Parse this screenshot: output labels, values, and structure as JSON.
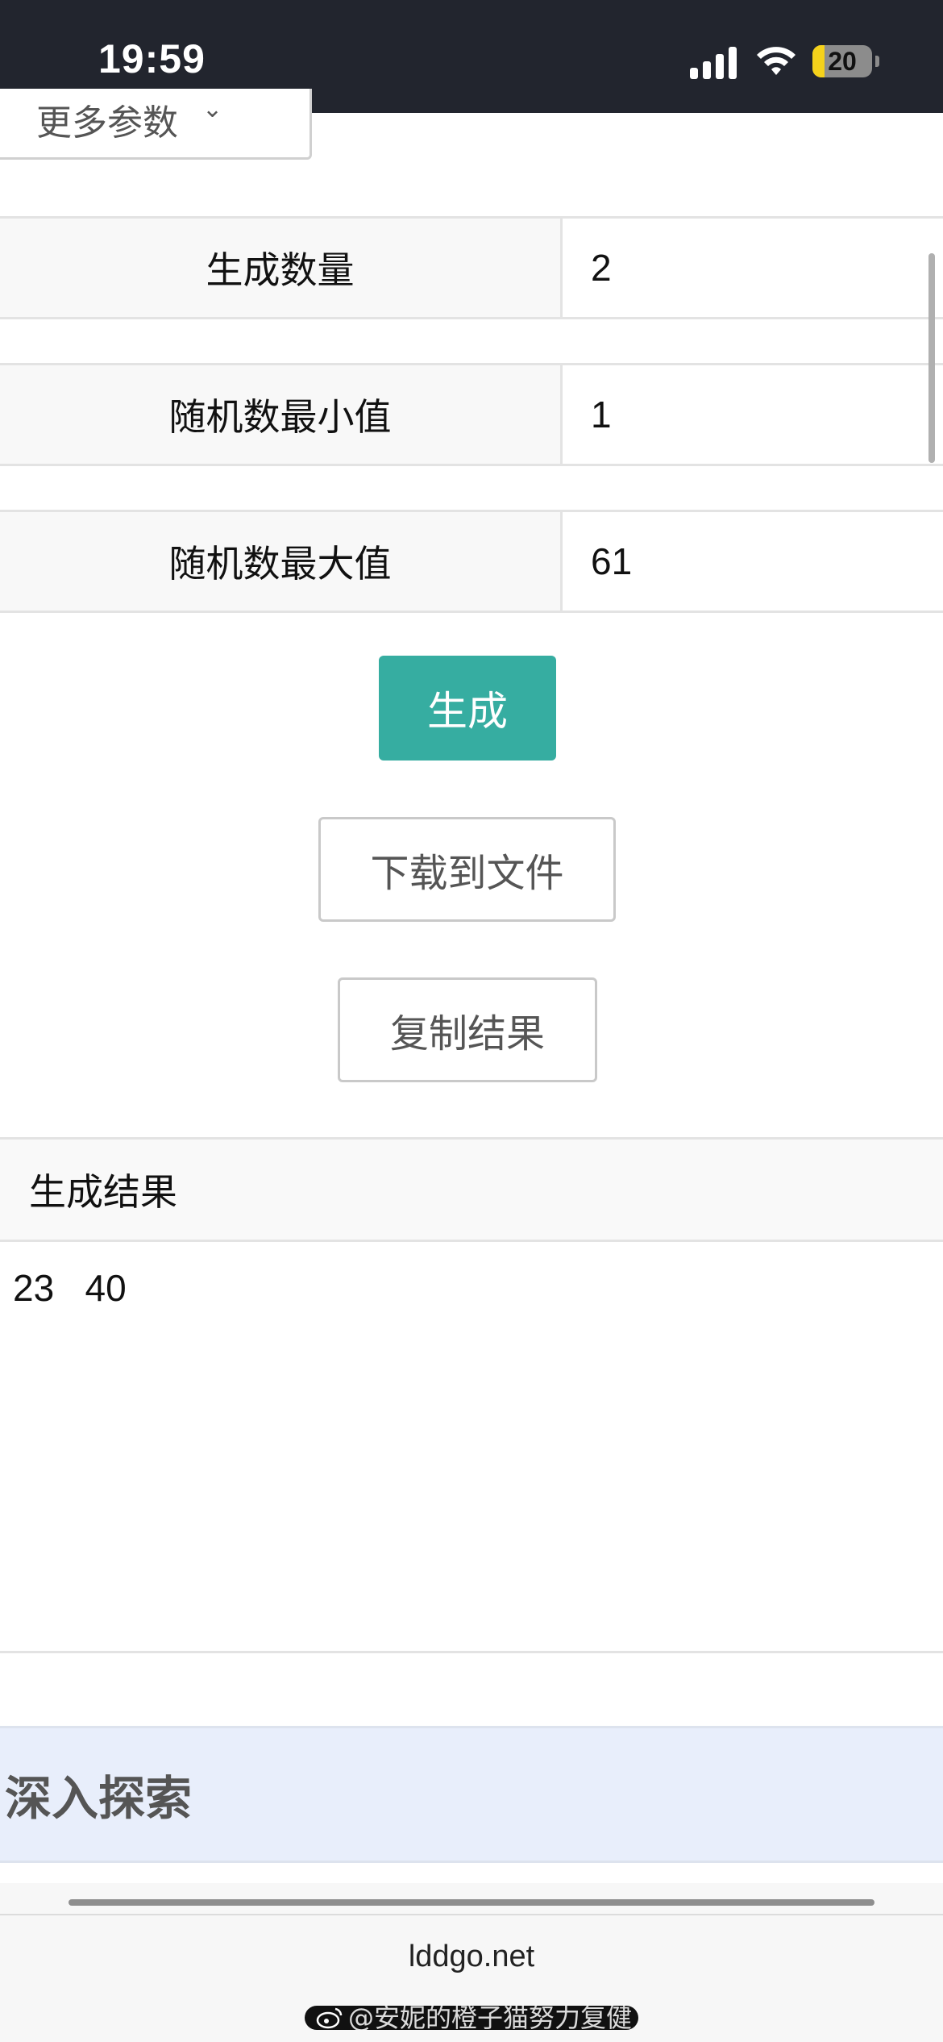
{
  "status_bar": {
    "time": "19:59",
    "battery_level": "20",
    "battery_fraction": 0.2,
    "colors": {
      "background": "#22252e",
      "battery_fill": "#f5d21b"
    }
  },
  "form": {
    "more_params_label": "更多参数",
    "params": [
      {
        "label": "生成数量",
        "value": "2"
      },
      {
        "label": "随机数最小值",
        "value": "1"
      },
      {
        "label": "随机数最大值",
        "value": "61"
      }
    ]
  },
  "actions": {
    "generate_label": "生成",
    "download_label": "下载到文件",
    "copy_label": "复制结果",
    "colors": {
      "primary": "#36ada1"
    }
  },
  "result": {
    "header": "生成结果",
    "values_text": "23   40"
  },
  "explore": {
    "title": "深入探索",
    "background": "#e8eefb"
  },
  "browser": {
    "url": "lddgo.net",
    "watermark": "@安妮的橙子猫努力复健"
  }
}
